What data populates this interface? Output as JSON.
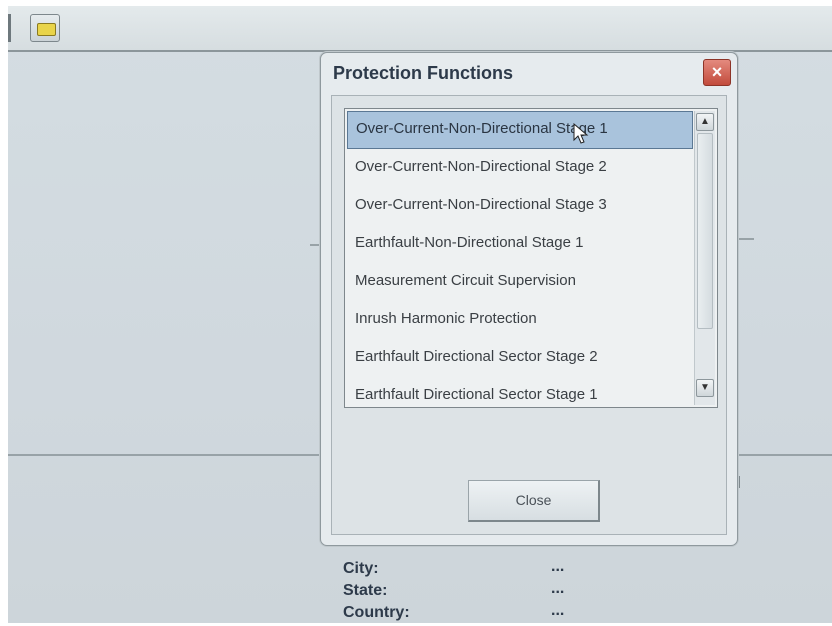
{
  "dialog": {
    "title": "Protection Functions",
    "close_icon": "×",
    "items": [
      "Over-Current-Non-Directional Stage 1",
      "Over-Current-Non-Directional Stage 2",
      "Over-Current-Non-Directional Stage 3",
      "Earthfault-Non-Directional Stage 1",
      "Measurement Circuit Supervision",
      "Inrush Harmonic Protection",
      "Earthfault Directional Sector Stage 2",
      "Earthfault Directional Sector Stage 1"
    ],
    "selected_item": "Over-Current-Non-Directional Stage 1",
    "scroll_up_icon": "▲",
    "scroll_down_icon": "▼",
    "close_button_label": "Close"
  },
  "info": {
    "rows": [
      {
        "label": "City:",
        "value": "..."
      },
      {
        "label": "State:",
        "value": "..."
      },
      {
        "label": "Country:",
        "value": "..."
      }
    ]
  },
  "colors": {
    "selection": "#a9c3dc",
    "close_button_red": "#c24b3c",
    "title_text": "#2d3a4a"
  },
  "icons": [
    "yellow-chip-icon",
    "close-icon",
    "scroll-up-icon",
    "scroll-down-icon",
    "mouse-pointer-icon"
  ]
}
